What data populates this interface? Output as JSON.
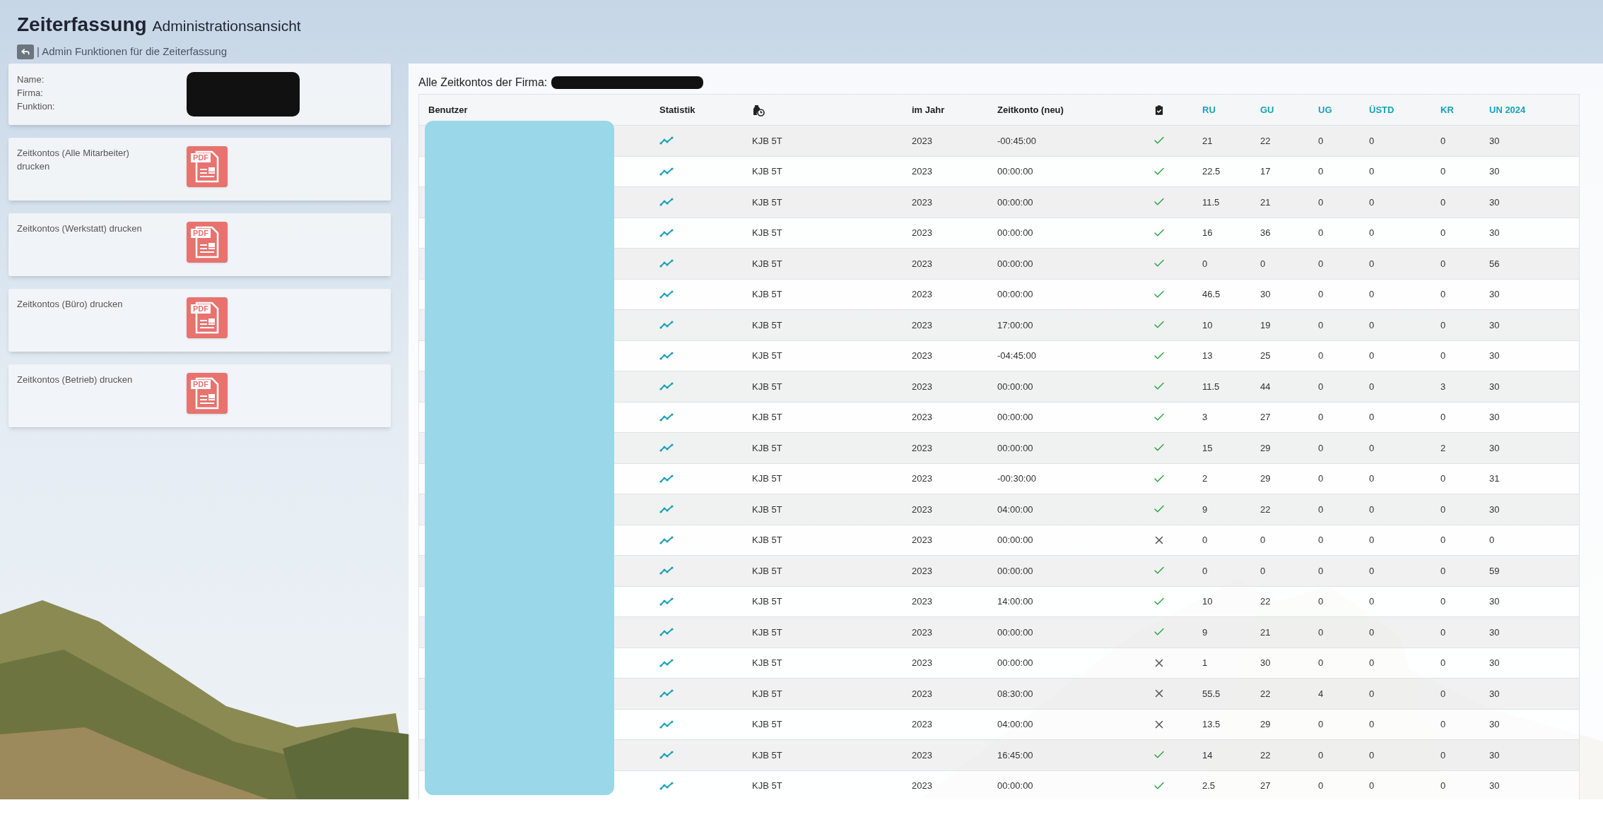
{
  "header": {
    "title": "Zeiterfassung",
    "subtitle": "Administrationsansicht",
    "breadcrumb": "| Admin Funktionen für die Zeiterfassung"
  },
  "profile": {
    "labels": [
      "Name:",
      "Firma:",
      "Funktion:"
    ]
  },
  "cards": [
    {
      "label": "Zeitkontos (Alle Mitarbeiter) drucken",
      "icon_label": "PDF"
    },
    {
      "label": "Zeitkontos (Werkstatt) drucken",
      "icon_label": "PDF"
    },
    {
      "label": "Zeitkontos (Büro) drucken",
      "icon_label": "PDF"
    },
    {
      "label": "Zeitkontos (Betrieb) drucken",
      "icon_label": "PDF"
    }
  ],
  "table": {
    "title": "Alle Zeitkontos der Firma:",
    "columns": [
      {
        "kind": "text",
        "label": "Benutzer",
        "link": false
      },
      {
        "kind": "text",
        "label": "Statistik",
        "link": false
      },
      {
        "kind": "bag_clock"
      },
      {
        "kind": "text",
        "label": "im Jahr",
        "link": false
      },
      {
        "kind": "text",
        "label": "Zeitkonto (neu)",
        "link": false
      },
      {
        "kind": "clipboard"
      },
      {
        "kind": "text",
        "label": "RU",
        "link": true
      },
      {
        "kind": "text",
        "label": "GU",
        "link": true
      },
      {
        "kind": "text",
        "label": "UG",
        "link": true
      },
      {
        "kind": "text",
        "label": "ÜSTD",
        "link": true
      },
      {
        "kind": "text",
        "label": "KR",
        "link": true
      },
      {
        "kind": "text",
        "label": "UN 2024",
        "link": true
      }
    ],
    "rows": [
      {
        "model": "KJB 5T",
        "year": "2023",
        "balance": "-00:45:00",
        "approved": true,
        "values": [
          "21",
          "22",
          "0",
          "0",
          "0",
          "30"
        ]
      },
      {
        "model": "KJB 5T",
        "year": "2023",
        "balance": "00:00:00",
        "approved": true,
        "values": [
          "22.5",
          "17",
          "0",
          "0",
          "0",
          "30"
        ]
      },
      {
        "model": "KJB 5T",
        "year": "2023",
        "balance": "00:00:00",
        "approved": true,
        "values": [
          "11.5",
          "21",
          "0",
          "0",
          "0",
          "30"
        ]
      },
      {
        "model": "KJB 5T",
        "year": "2023",
        "balance": "00:00:00",
        "approved": true,
        "values": [
          "16",
          "36",
          "0",
          "0",
          "0",
          "30"
        ]
      },
      {
        "model": "KJB 5T",
        "year": "2023",
        "balance": "00:00:00",
        "approved": true,
        "values": [
          "0",
          "0",
          "0",
          "0",
          "0",
          "56"
        ]
      },
      {
        "model": "KJB 5T",
        "year": "2023",
        "balance": "00:00:00",
        "approved": true,
        "values": [
          "46.5",
          "30",
          "0",
          "0",
          "0",
          "30"
        ]
      },
      {
        "model": "KJB 5T",
        "year": "2023",
        "balance": "17:00:00",
        "approved": true,
        "values": [
          "10",
          "19",
          "0",
          "0",
          "0",
          "30"
        ]
      },
      {
        "model": "KJB 5T",
        "year": "2023",
        "balance": "-04:45:00",
        "approved": true,
        "values": [
          "13",
          "25",
          "0",
          "0",
          "0",
          "30"
        ]
      },
      {
        "model": "KJB 5T",
        "year": "2023",
        "balance": "00:00:00",
        "approved": true,
        "values": [
          "11.5",
          "44",
          "0",
          "0",
          "3",
          "30"
        ]
      },
      {
        "model": "KJB 5T",
        "year": "2023",
        "balance": "00:00:00",
        "approved": true,
        "values": [
          "3",
          "27",
          "0",
          "0",
          "0",
          "30"
        ]
      },
      {
        "model": "KJB 5T",
        "year": "2023",
        "balance": "00:00:00",
        "approved": true,
        "values": [
          "15",
          "29",
          "0",
          "0",
          "2",
          "30"
        ]
      },
      {
        "model": "KJB 5T",
        "year": "2023",
        "balance": "-00:30:00",
        "approved": true,
        "values": [
          "2",
          "29",
          "0",
          "0",
          "0",
          "31"
        ]
      },
      {
        "model": "KJB 5T",
        "year": "2023",
        "balance": "04:00:00",
        "approved": true,
        "values": [
          "9",
          "22",
          "0",
          "0",
          "0",
          "30"
        ]
      },
      {
        "model": "KJB 5T",
        "year": "2023",
        "balance": "00:00:00",
        "approved": false,
        "values": [
          "0",
          "0",
          "0",
          "0",
          "0",
          "0"
        ]
      },
      {
        "model": "KJB 5T",
        "year": "2023",
        "balance": "00:00:00",
        "approved": true,
        "values": [
          "0",
          "0",
          "0",
          "0",
          "0",
          "59"
        ]
      },
      {
        "model": "KJB 5T",
        "year": "2023",
        "balance": "14:00:00",
        "approved": true,
        "values": [
          "10",
          "22",
          "0",
          "0",
          "0",
          "30"
        ]
      },
      {
        "model": "KJB 5T",
        "year": "2023",
        "balance": "00:00:00",
        "approved": true,
        "values": [
          "9",
          "21",
          "0",
          "0",
          "0",
          "30"
        ]
      },
      {
        "model": "KJB 5T",
        "year": "2023",
        "balance": "00:00:00",
        "approved": false,
        "values": [
          "1",
          "30",
          "0",
          "0",
          "0",
          "30"
        ]
      },
      {
        "model": "KJB 5T",
        "year": "2023",
        "balance": "08:30:00",
        "approved": false,
        "values": [
          "55.5",
          "22",
          "4",
          "0",
          "0",
          "30"
        ]
      },
      {
        "model": "KJB 5T",
        "year": "2023",
        "balance": "04:00:00",
        "approved": false,
        "values": [
          "13.5",
          "29",
          "0",
          "0",
          "0",
          "30"
        ]
      },
      {
        "model": "KJB 5T",
        "year": "2023",
        "balance": "16:45:00",
        "approved": true,
        "values": [
          "14",
          "22",
          "0",
          "0",
          "0",
          "30"
        ]
      },
      {
        "model": "KJB 5T",
        "year": "2023",
        "balance": "00:00:00",
        "approved": true,
        "values": [
          "2.5",
          "27",
          "0",
          "0",
          "0",
          "30"
        ]
      }
    ]
  }
}
